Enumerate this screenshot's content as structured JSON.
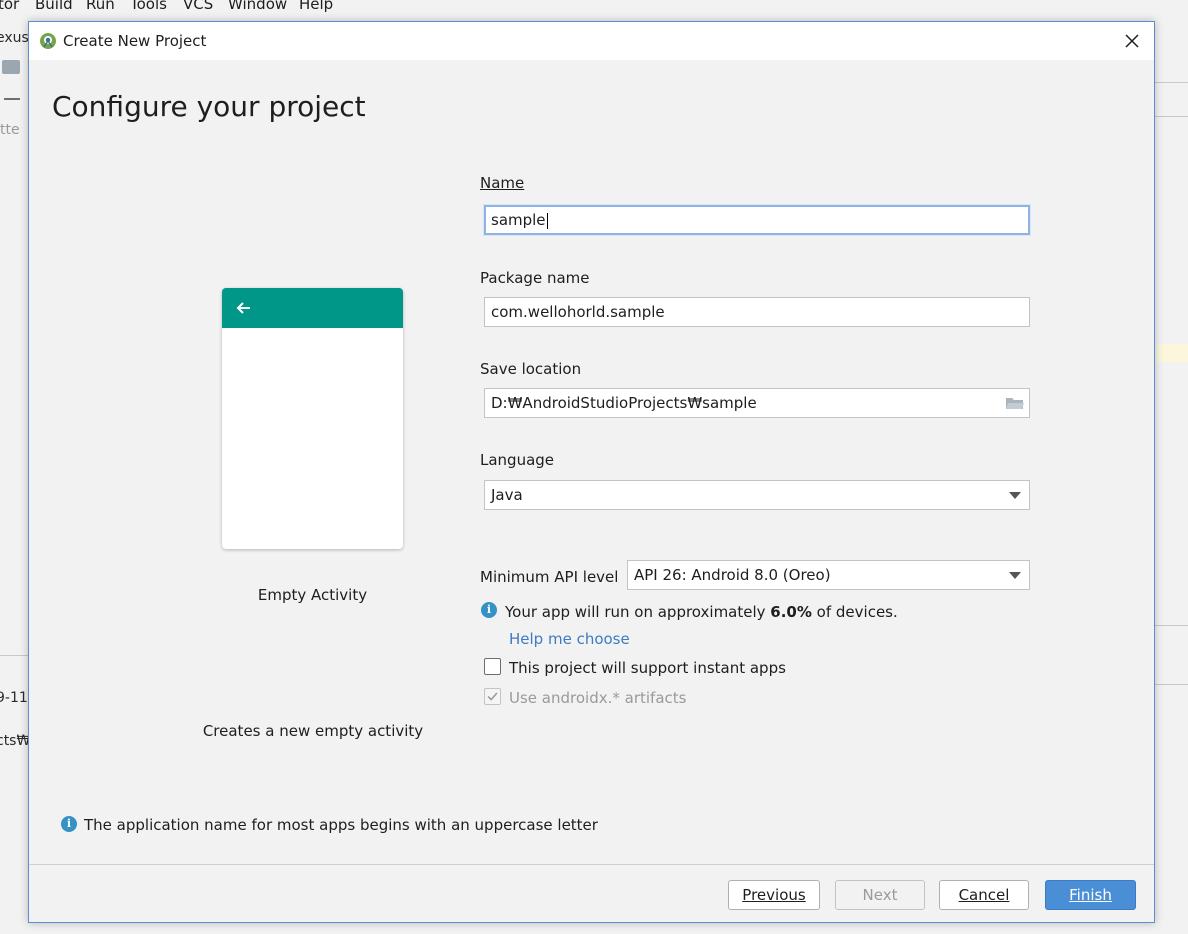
{
  "ide": {
    "menu": [
      "tor",
      "Build",
      "Run",
      "Tools",
      "VCS",
      "Window",
      "Help"
    ],
    "left_fragments": [
      "exus",
      "tte",
      "9-11-",
      "cts₩"
    ]
  },
  "dialog": {
    "title": "Create New Project",
    "heading": "Configure your project",
    "template": {
      "name": "Empty Activity",
      "description": "Creates a new empty activity"
    },
    "form": {
      "name_label": "Name",
      "name_value": "sample",
      "package_label": "Package name",
      "package_value": "com.wellohorld.sample",
      "save_label": "Save location",
      "save_value": "D:₩AndroidStudioProjects₩sample",
      "language_label": "Language",
      "language_value": "Java",
      "min_api_label": "Minimum API level",
      "min_api_value": "API 26: Android 8.0 (Oreo)",
      "devices_prefix": "Your app will run on approximately ",
      "devices_percent": "6.0%",
      "devices_suffix": " of devices.",
      "help_link": "Help me choose",
      "instant_apps_label": "This project will support instant apps",
      "instant_apps_checked": false,
      "androidx_label": "Use androidx.* artifacts",
      "androidx_checked": true
    },
    "hint": "The application name for most apps begins with an uppercase letter",
    "buttons": {
      "previous": "Previous",
      "next": "Next",
      "cancel": "Cancel",
      "finish": "Finish"
    }
  },
  "colors": {
    "toolbar_teal": "#009688",
    "accent_blue": "#4a8ed6",
    "info_blue": "#3592c4",
    "link_blue": "#3b7cc4"
  },
  "icons": [
    "android-studio-icon",
    "close-icon",
    "arrow-back-icon",
    "folder-icon",
    "chevron-down-icon",
    "info-icon"
  ]
}
